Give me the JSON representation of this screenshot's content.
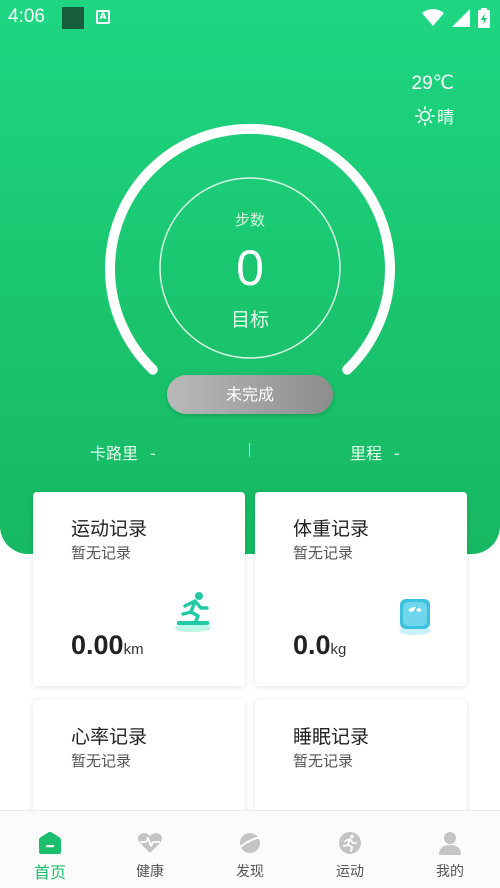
{
  "status_bar": {
    "time": "4:06",
    "indicator_letter": "A"
  },
  "weather": {
    "temperature": "29℃",
    "condition": "晴"
  },
  "steps": {
    "label": "步数",
    "value": "0",
    "goal_label": "目标",
    "progress": 0
  },
  "status_button": "未完成",
  "stats": {
    "calories_label": "卡路里",
    "calories_value": "-",
    "distance_label": "里程",
    "distance_value": "-"
  },
  "cards": [
    {
      "title": "运动记录",
      "subtitle": "暂无记录",
      "value": "0.00",
      "unit": "km",
      "icon": "running-treadmill-icon"
    },
    {
      "title": "体重记录",
      "subtitle": "暂无记录",
      "value": "0.0",
      "unit": "kg",
      "icon": "scale-icon"
    },
    {
      "title": "心率记录",
      "subtitle": "暂无记录"
    },
    {
      "title": "睡眠记录",
      "subtitle": "暂无记录"
    }
  ],
  "nav": [
    {
      "label": "首页",
      "icon": "home-icon",
      "active": true
    },
    {
      "label": "健康",
      "icon": "heart-pulse-icon",
      "active": false
    },
    {
      "label": "发现",
      "icon": "planet-icon",
      "active": false
    },
    {
      "label": "运动",
      "icon": "runner-icon",
      "active": false
    },
    {
      "label": "我的",
      "icon": "profile-icon",
      "active": false
    }
  ],
  "colors": {
    "accent": "#1ac56e",
    "accent_light": "#1ed682",
    "nav_inactive": "#bdbdbd",
    "pill_gray": "#a5a5a5"
  }
}
